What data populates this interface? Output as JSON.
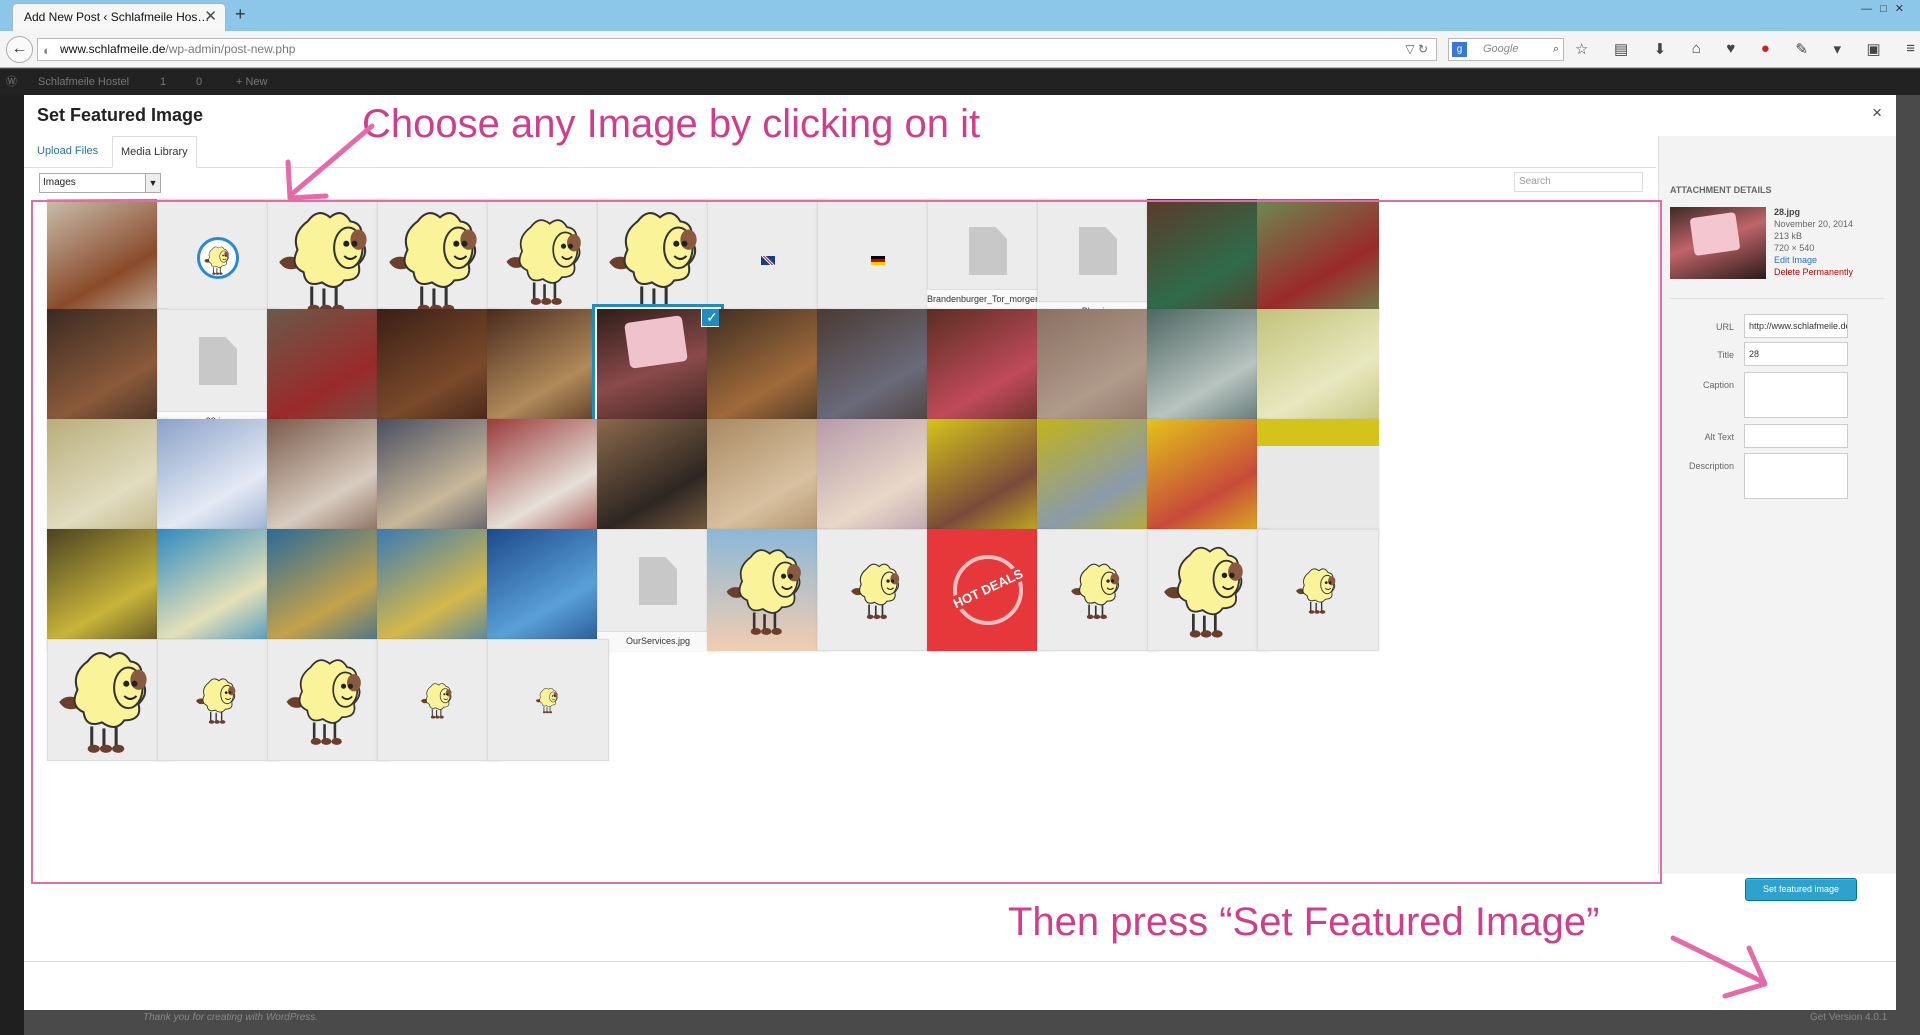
{
  "browser": {
    "tab_title": "Add New Post ‹ Schlafmeile Hos…",
    "tab_close": "✕",
    "new_tab": "+",
    "window_controls": "—□✕",
    "url_host": "www.schlafmeile.de",
    "url_path": "/wp-admin/post-new.php",
    "search_engine": "Google",
    "search_placeholder": "Google",
    "toolbar_icons": [
      "bookmark-star-icon",
      "reading-list-icon",
      "download-icon",
      "home-icon",
      "heart-icon",
      "adblock-icon",
      "dev-tools-icon",
      "menu-dropdown-icon",
      "sync-icon",
      "hamburger-menu-icon"
    ]
  },
  "admin_bar": {
    "site_name": "Schlafmeile Hostel",
    "updates": "1",
    "comments": "0",
    "new": "+ New"
  },
  "modal": {
    "title": "Set Featured Image",
    "close": "×",
    "tabs": [
      "Upload Files",
      "Media Library"
    ],
    "filter_value": "Images",
    "search_placeholder": "Search",
    "button_label": "Set featured image"
  },
  "annotations": {
    "top": "Choose any Image by clicking on it",
    "bottom": "Then press “Set Featured Image”"
  },
  "attachment_details": {
    "heading": "ATTACHMENT DETAILS",
    "filename": "28.jpg",
    "date": "November 20, 2014",
    "size": "213 kB",
    "dimensions": "720 × 540",
    "edit_link": "Edit Image",
    "delete_link": "Delete Permanently",
    "fields": [
      {
        "label": "URL",
        "value": "http://www.schlafmeile.de/w"
      },
      {
        "label": "Title",
        "value": "28"
      },
      {
        "label": "Caption",
        "value": ""
      },
      {
        "label": "Alt Text",
        "value": ""
      },
      {
        "label": "Description",
        "value": ""
      }
    ]
  },
  "footer": {
    "thanks": "Thank you for creating with WordPress.",
    "version": "Get Version 4.0.1"
  },
  "colors": {
    "accent": "#2ea2cc",
    "annotation": "#cf3e8b",
    "selected_border": "#1e8cbe"
  },
  "media_items": [
    {
      "kind": "photo",
      "bg": "#c9bfae",
      "fg": "#8a4a2a"
    },
    {
      "kind": "sheep-bubble"
    },
    {
      "kind": "sheep",
      "scale": 1.0
    },
    {
      "kind": "sheep",
      "scale": 1.0
    },
    {
      "kind": "sheep",
      "scale": 0.85
    },
    {
      "kind": "sheep",
      "scale": 1.0
    },
    {
      "kind": "flag",
      "flag": "uk"
    },
    {
      "kind": "flag",
      "flag": "de"
    },
    {
      "kind": "doc",
      "name": "Brandenburger_Tor_morgens.jpg"
    },
    {
      "kind": "doc",
      "name": "Blog.jpg"
    },
    {
      "kind": "photo",
      "bg": "#5b3a2a",
      "fg": "#2f6b4a"
    },
    {
      "kind": "photo",
      "bg": "#6b8a52",
      "fg": "#9a2a2a"
    },
    {
      "kind": "photo",
      "bg": "#3a2a22",
      "fg": "#8a5a3a"
    },
    {
      "kind": "doc",
      "name": "32.jpg"
    },
    {
      "kind": "photo",
      "bg": "#6a5a4a",
      "fg": "#9a2a2a"
    },
    {
      "kind": "photo",
      "bg": "#3a1e16",
      "fg": "#7a4a2a"
    },
    {
      "kind": "photo",
      "bg": "#4a2a1e",
      "fg": "#b08a5a"
    },
    {
      "kind": "photo",
      "bg": "#2e1e1a",
      "fg": "#e8b8c4",
      "selected": true
    },
    {
      "kind": "photo",
      "bg": "#3e2e22",
      "fg": "#a06a3a"
    },
    {
      "kind": "photo",
      "bg": "#4a3a32",
      "fg": "#6a6a7a"
    },
    {
      "kind": "photo",
      "bg": "#5a2e22",
      "fg": "#c04a5a"
    },
    {
      "kind": "photo",
      "bg": "#8a7062",
      "fg": "#b09a8a"
    },
    {
      "kind": "photo",
      "bg": "#4e6662",
      "fg": "#b8c4c0"
    },
    {
      "kind": "photo",
      "bg": "#c2c27a",
      "fg": "#e8e8c0"
    },
    {
      "kind": "photo",
      "bg": "#b8ae7a",
      "fg": "#e2dcc0"
    },
    {
      "kind": "photo",
      "bg": "#8aa2c8",
      "fg": "#e4eaf4"
    },
    {
      "kind": "photo",
      "bg": "#7a5a4a",
      "fg": "#d8ccc0"
    },
    {
      "kind": "photo",
      "bg": "#4a4e62",
      "fg": "#c8b89a"
    },
    {
      "kind": "photo",
      "bg": "#9a3a3a",
      "fg": "#e6e0d8"
    },
    {
      "kind": "photo",
      "bg": "#8a6a4a",
      "fg": "#2e2622"
    },
    {
      "kind": "photo",
      "bg": "#a88a62",
      "fg": "#d8c0a0"
    },
    {
      "kind": "photo",
      "bg": "#b89aaa",
      "fg": "#e8d8c8"
    },
    {
      "kind": "photo",
      "bg": "#d4c41a",
      "fg": "#7a4a3a"
    },
    {
      "kind": "photo",
      "bg": "#c2b418",
      "fg": "#8a9aaa"
    },
    {
      "kind": "photo",
      "bg": "#e2c41a",
      "fg": "#c84a3a"
    },
    {
      "kind": "photo",
      "bg": "#e8e8e8",
      "fg": "#d4c41a",
      "half": true
    },
    {
      "kind": "photo",
      "bg": "#4a4222",
      "fg": "#c8b43a"
    },
    {
      "kind": "photo",
      "bg": "#2e8ac0",
      "fg": "#e4e0b8"
    },
    {
      "kind": "photo",
      "bg": "#2a6a9a",
      "fg": "#c4a24a"
    },
    {
      "kind": "photo",
      "bg": "#3a7ab4",
      "fg": "#d4b84a"
    },
    {
      "kind": "photo",
      "bg": "#1c4a8a",
      "fg": "#5aa0d8"
    },
    {
      "kind": "doc",
      "name": "OurServices.jpg"
    },
    {
      "kind": "sheep-gradient"
    },
    {
      "kind": "sheep",
      "scale": 0.55
    },
    {
      "kind": "hotdeals",
      "text": "HOT DEALS"
    },
    {
      "kind": "sheep",
      "scale": 0.55
    },
    {
      "kind": "sheep",
      "scale": 0.9
    },
    {
      "kind": "sheep",
      "scale": 0.45
    },
    {
      "kind": "sheep",
      "scale": 1.0
    },
    {
      "kind": "sheep",
      "scale": 0.45
    },
    {
      "kind": "sheep",
      "scale": 0.85
    },
    {
      "kind": "sheep",
      "scale": 0.35
    },
    {
      "kind": "sheep",
      "scale": 0.25
    }
  ]
}
